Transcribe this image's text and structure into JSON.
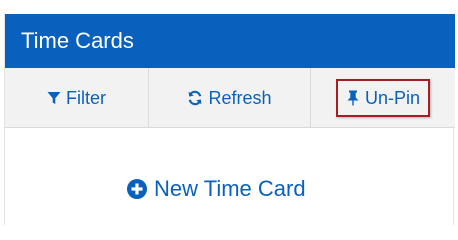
{
  "panel": {
    "title": "Time Cards"
  },
  "toolbar": {
    "filter_label": "Filter",
    "refresh_label": "Refresh",
    "unpin_label": "Un-Pin"
  },
  "content": {
    "new_card_label": "New Time Card"
  },
  "icons": {
    "filter": "filter-icon",
    "refresh": "refresh-icon",
    "unpin": "pushpin-icon",
    "new": "plus-circle-icon"
  },
  "colors": {
    "header_bg": "#0a61bd",
    "accent": "#0a61bd",
    "toolbar_bg": "#f2f2f2",
    "highlight_border": "#a51e24"
  }
}
